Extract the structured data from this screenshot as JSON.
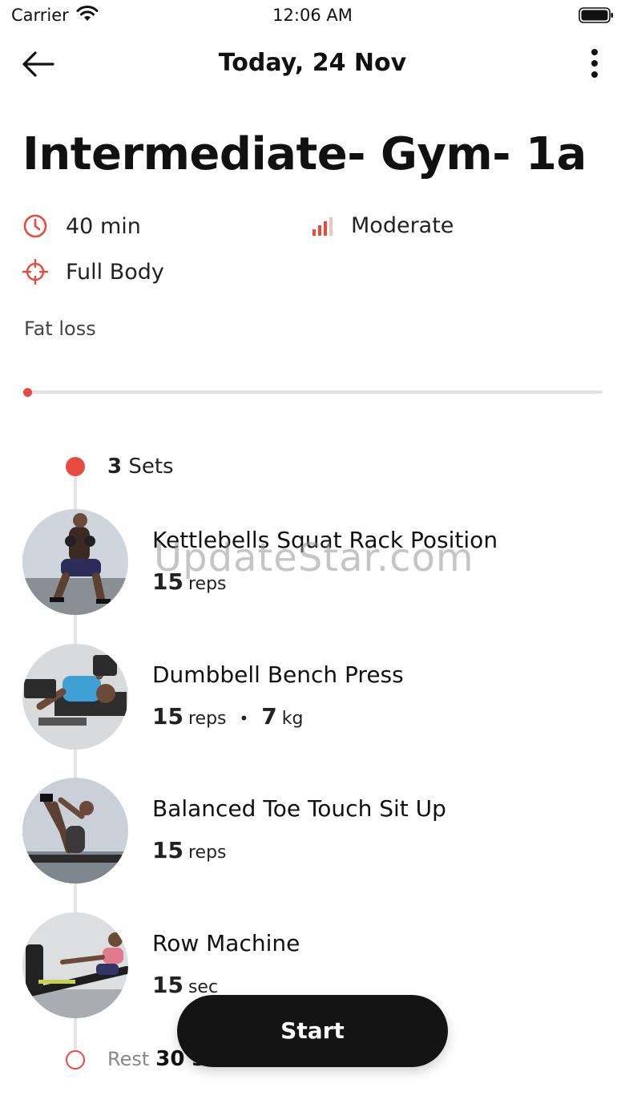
{
  "status_bar": {
    "carrier": "Carrier",
    "time": "12:06 AM"
  },
  "nav": {
    "title": "Today, 24 Nov"
  },
  "workout": {
    "title": "Intermediate- Gym- 1a",
    "duration": "40 min",
    "difficulty": "Moderate",
    "focus": "Full Body",
    "goal": "Fat loss",
    "progress": 0
  },
  "sets_block": {
    "count": "3",
    "label": "Sets"
  },
  "exercises": [
    {
      "name": "Kettlebells Squat Rack Position",
      "amount": "15",
      "unit": "reps"
    },
    {
      "name": "Dumbbell Bench Press",
      "amount": "15",
      "unit": "reps",
      "weight": "7",
      "weight_unit": "kg"
    },
    {
      "name": "Balanced Toe Touch Sit Up",
      "amount": "15",
      "unit": "reps"
    },
    {
      "name": "Row Machine",
      "amount": "15",
      "unit": "sec"
    }
  ],
  "rest": {
    "label": "Rest",
    "value": "30 s"
  },
  "start_label": "Start",
  "watermark": "UpdateStar.com",
  "colors": {
    "accent": "#ea4a3d",
    "button": "#141414",
    "track": "#e3e3e3"
  }
}
